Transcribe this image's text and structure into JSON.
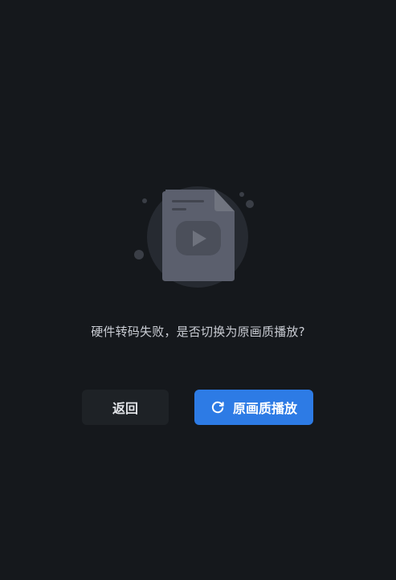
{
  "dialog": {
    "illustration_icon": "file-video-icon",
    "message": "硬件转码失败，是否切换为原画质播放?"
  },
  "actions": {
    "back_label": "返回",
    "original_quality_label": "原画质播放",
    "original_quality_icon": "refresh-icon"
  },
  "colors": {
    "background": "#15181c",
    "primary": "#2d7be5",
    "secondary_button": "#1e2226",
    "illustration": "#5b5f6d"
  }
}
